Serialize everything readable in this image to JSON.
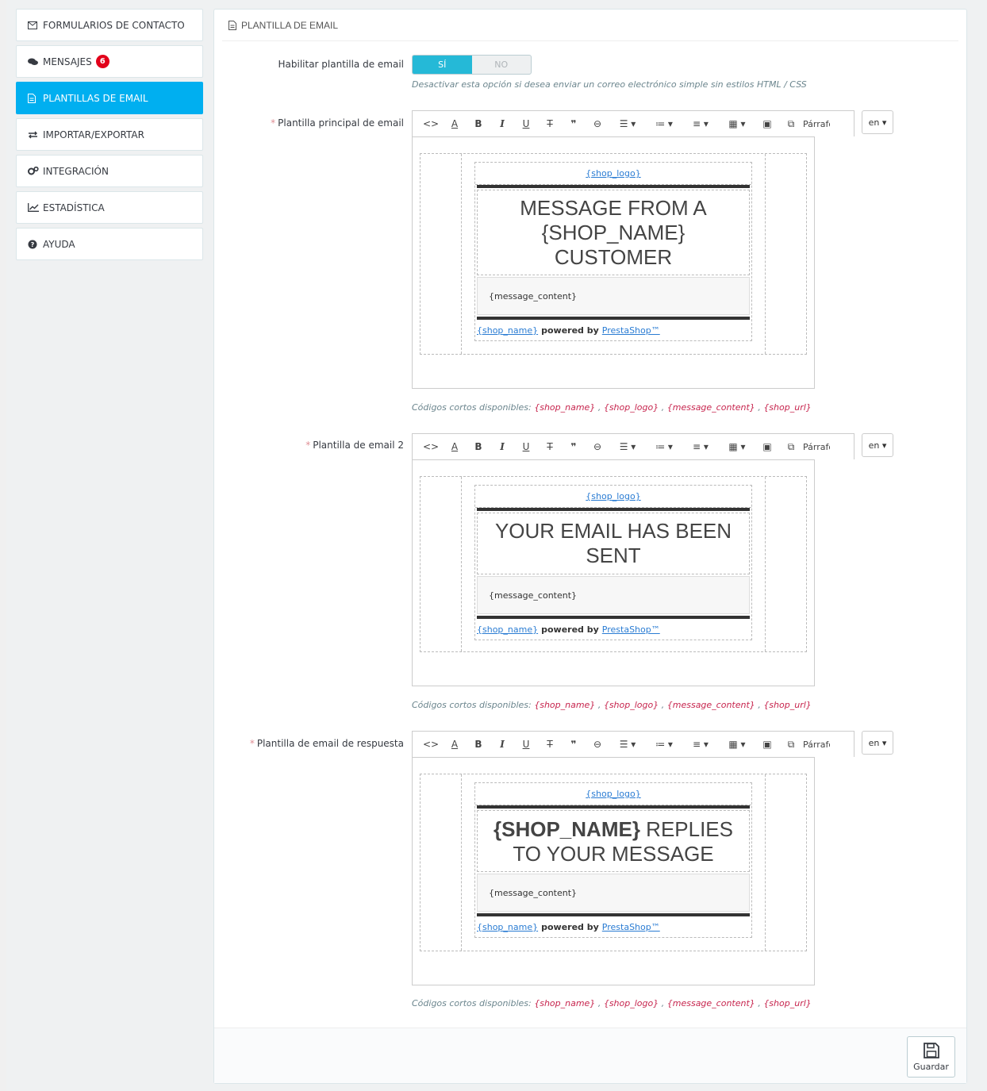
{
  "sidebar": {
    "items": [
      {
        "label": "FORMULARIOS DE CONTACTO",
        "icon": "envelope-icon"
      },
      {
        "label": "MENSAJES",
        "icon": "comments-icon",
        "badge": "6"
      },
      {
        "label": "PLANTILLAS DE EMAIL",
        "icon": "file-icon",
        "active": true
      },
      {
        "label": "IMPORTAR/EXPORTAR",
        "icon": "exchange-icon"
      },
      {
        "label": "INTEGRACIÓN",
        "icon": "cogs-icon"
      },
      {
        "label": "ESTADÍSTICA",
        "icon": "line-chart-icon"
      },
      {
        "label": "AYUDA",
        "icon": "question-circle-icon"
      }
    ]
  },
  "panel": {
    "title": "PLANTILLA DE EMAIL",
    "enable_label": "Habilitar plantilla de email",
    "toggle_on": "SÍ",
    "toggle_off": "NO",
    "enable_help": "Desactivar esta opción si desea enviar un correo electrónico simple sin estilos HTML / CSS",
    "shortcodes_prefix": "Códigos cortos disponibles:",
    "shortcodes": [
      "{shop_name}",
      "{shop_logo}",
      "{message_content}",
      "{shop_url}"
    ],
    "shortcode_sep": ",",
    "toolbar": {
      "paragraph": "Párrafo",
      "lang": "en"
    },
    "templates": [
      {
        "label": "Plantilla principal de email",
        "logo": "{shop_logo}",
        "title": "MESSAGE FROM A {SHOP_NAME} CUSTOMER",
        "message": "{message_content}",
        "footer_name": "{shop_name}",
        "footer_powered": "powered by",
        "footer_link": "PrestaShop™"
      },
      {
        "label": "Plantilla de email 2",
        "logo": "{shop_logo}",
        "title": "YOUR EMAIL HAS BEEN SENT",
        "message": "{message_content}",
        "footer_name": "{shop_name}",
        "footer_powered": "powered by",
        "footer_link": "PrestaShop™"
      },
      {
        "label": "Plantilla de email de respuesta",
        "logo": "{shop_logo}",
        "title_bold": "{SHOP_NAME}",
        "title": " REPLIES TO YOUR MESSAGE",
        "message": "{message_content}",
        "footer_name": "{shop_name}",
        "footer_powered": "powered by",
        "footer_link": "PrestaShop™"
      }
    ],
    "save_label": "Guardar"
  },
  "colors": {
    "accent": "#00aff0",
    "toggle_on": "#25b9d7",
    "badge": "#e2001a",
    "code": "#c7254e"
  }
}
